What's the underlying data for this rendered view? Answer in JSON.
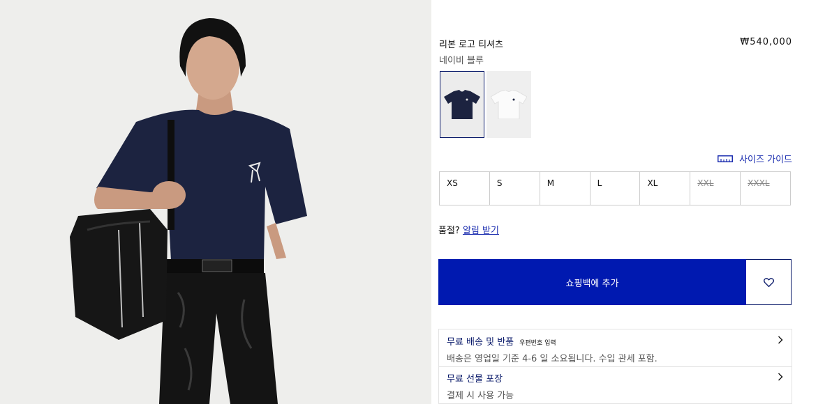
{
  "product": {
    "title": "리본 로고 티셔츠",
    "price": "₩540,000",
    "color_name": "네이비 블루"
  },
  "swatches": [
    {
      "color": "navy",
      "hex": "#1c2340",
      "selected": true
    },
    {
      "color": "white",
      "hex": "#f6f6f6",
      "selected": false
    }
  ],
  "size_guide_label": "사이즈 가이드",
  "sizes": [
    {
      "label": "XS",
      "available": true
    },
    {
      "label": "S",
      "available": true
    },
    {
      "label": "M",
      "available": true
    },
    {
      "label": "L",
      "available": true
    },
    {
      "label": "XL",
      "available": true
    },
    {
      "label": "XXL",
      "available": false
    },
    {
      "label": "XXXL",
      "available": false
    }
  ],
  "notify": {
    "prefix": "품절?",
    "link": "알림 받기"
  },
  "cta": {
    "add_label": "쇼핑백에 추가",
    "wishlist_icon": "heart-icon"
  },
  "info": [
    {
      "title": "무료 배송 및 반품",
      "sub": "우편번호 입력",
      "desc": "배송은 영업일 기준 4-6 일 소요됩니다. 수입 관세 포함."
    },
    {
      "title": "무료 선물 포장",
      "desc": "결제 시 사용 가능"
    }
  ],
  "colors": {
    "accent": "#0019b0",
    "navy": "#0a1a6a",
    "link": "#1d2fb0"
  }
}
